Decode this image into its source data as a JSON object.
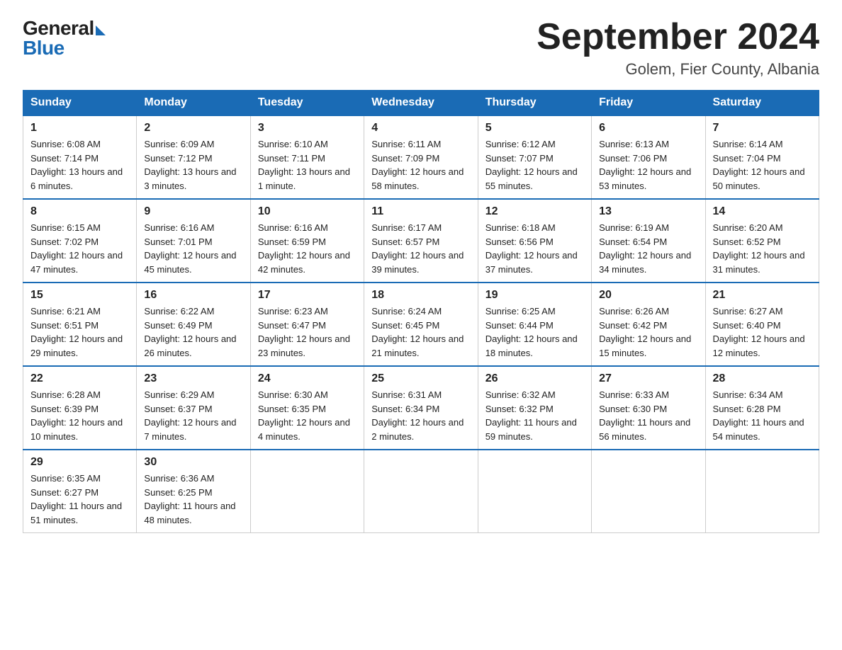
{
  "logo": {
    "general": "General",
    "blue": "Blue"
  },
  "title": {
    "month": "September 2024",
    "location": "Golem, Fier County, Albania"
  },
  "calendar": {
    "headers": [
      "Sunday",
      "Monday",
      "Tuesday",
      "Wednesday",
      "Thursday",
      "Friday",
      "Saturday"
    ],
    "weeks": [
      [
        {
          "day": "1",
          "sunrise": "6:08 AM",
          "sunset": "7:14 PM",
          "daylight": "13 hours and 6 minutes."
        },
        {
          "day": "2",
          "sunrise": "6:09 AM",
          "sunset": "7:12 PM",
          "daylight": "13 hours and 3 minutes."
        },
        {
          "day": "3",
          "sunrise": "6:10 AM",
          "sunset": "7:11 PM",
          "daylight": "13 hours and 1 minute."
        },
        {
          "day": "4",
          "sunrise": "6:11 AM",
          "sunset": "7:09 PM",
          "daylight": "12 hours and 58 minutes."
        },
        {
          "day": "5",
          "sunrise": "6:12 AM",
          "sunset": "7:07 PM",
          "daylight": "12 hours and 55 minutes."
        },
        {
          "day": "6",
          "sunrise": "6:13 AM",
          "sunset": "7:06 PM",
          "daylight": "12 hours and 53 minutes."
        },
        {
          "day": "7",
          "sunrise": "6:14 AM",
          "sunset": "7:04 PM",
          "daylight": "12 hours and 50 minutes."
        }
      ],
      [
        {
          "day": "8",
          "sunrise": "6:15 AM",
          "sunset": "7:02 PM",
          "daylight": "12 hours and 47 minutes."
        },
        {
          "day": "9",
          "sunrise": "6:16 AM",
          "sunset": "7:01 PM",
          "daylight": "12 hours and 45 minutes."
        },
        {
          "day": "10",
          "sunrise": "6:16 AM",
          "sunset": "6:59 PM",
          "daylight": "12 hours and 42 minutes."
        },
        {
          "day": "11",
          "sunrise": "6:17 AM",
          "sunset": "6:57 PM",
          "daylight": "12 hours and 39 minutes."
        },
        {
          "day": "12",
          "sunrise": "6:18 AM",
          "sunset": "6:56 PM",
          "daylight": "12 hours and 37 minutes."
        },
        {
          "day": "13",
          "sunrise": "6:19 AM",
          "sunset": "6:54 PM",
          "daylight": "12 hours and 34 minutes."
        },
        {
          "day": "14",
          "sunrise": "6:20 AM",
          "sunset": "6:52 PM",
          "daylight": "12 hours and 31 minutes."
        }
      ],
      [
        {
          "day": "15",
          "sunrise": "6:21 AM",
          "sunset": "6:51 PM",
          "daylight": "12 hours and 29 minutes."
        },
        {
          "day": "16",
          "sunrise": "6:22 AM",
          "sunset": "6:49 PM",
          "daylight": "12 hours and 26 minutes."
        },
        {
          "day": "17",
          "sunrise": "6:23 AM",
          "sunset": "6:47 PM",
          "daylight": "12 hours and 23 minutes."
        },
        {
          "day": "18",
          "sunrise": "6:24 AM",
          "sunset": "6:45 PM",
          "daylight": "12 hours and 21 minutes."
        },
        {
          "day": "19",
          "sunrise": "6:25 AM",
          "sunset": "6:44 PM",
          "daylight": "12 hours and 18 minutes."
        },
        {
          "day": "20",
          "sunrise": "6:26 AM",
          "sunset": "6:42 PM",
          "daylight": "12 hours and 15 minutes."
        },
        {
          "day": "21",
          "sunrise": "6:27 AM",
          "sunset": "6:40 PM",
          "daylight": "12 hours and 12 minutes."
        }
      ],
      [
        {
          "day": "22",
          "sunrise": "6:28 AM",
          "sunset": "6:39 PM",
          "daylight": "12 hours and 10 minutes."
        },
        {
          "day": "23",
          "sunrise": "6:29 AM",
          "sunset": "6:37 PM",
          "daylight": "12 hours and 7 minutes."
        },
        {
          "day": "24",
          "sunrise": "6:30 AM",
          "sunset": "6:35 PM",
          "daylight": "12 hours and 4 minutes."
        },
        {
          "day": "25",
          "sunrise": "6:31 AM",
          "sunset": "6:34 PM",
          "daylight": "12 hours and 2 minutes."
        },
        {
          "day": "26",
          "sunrise": "6:32 AM",
          "sunset": "6:32 PM",
          "daylight": "11 hours and 59 minutes."
        },
        {
          "day": "27",
          "sunrise": "6:33 AM",
          "sunset": "6:30 PM",
          "daylight": "11 hours and 56 minutes."
        },
        {
          "day": "28",
          "sunrise": "6:34 AM",
          "sunset": "6:28 PM",
          "daylight": "11 hours and 54 minutes."
        }
      ],
      [
        {
          "day": "29",
          "sunrise": "6:35 AM",
          "sunset": "6:27 PM",
          "daylight": "11 hours and 51 minutes."
        },
        {
          "day": "30",
          "sunrise": "6:36 AM",
          "sunset": "6:25 PM",
          "daylight": "11 hours and 48 minutes."
        },
        null,
        null,
        null,
        null,
        null
      ]
    ]
  }
}
